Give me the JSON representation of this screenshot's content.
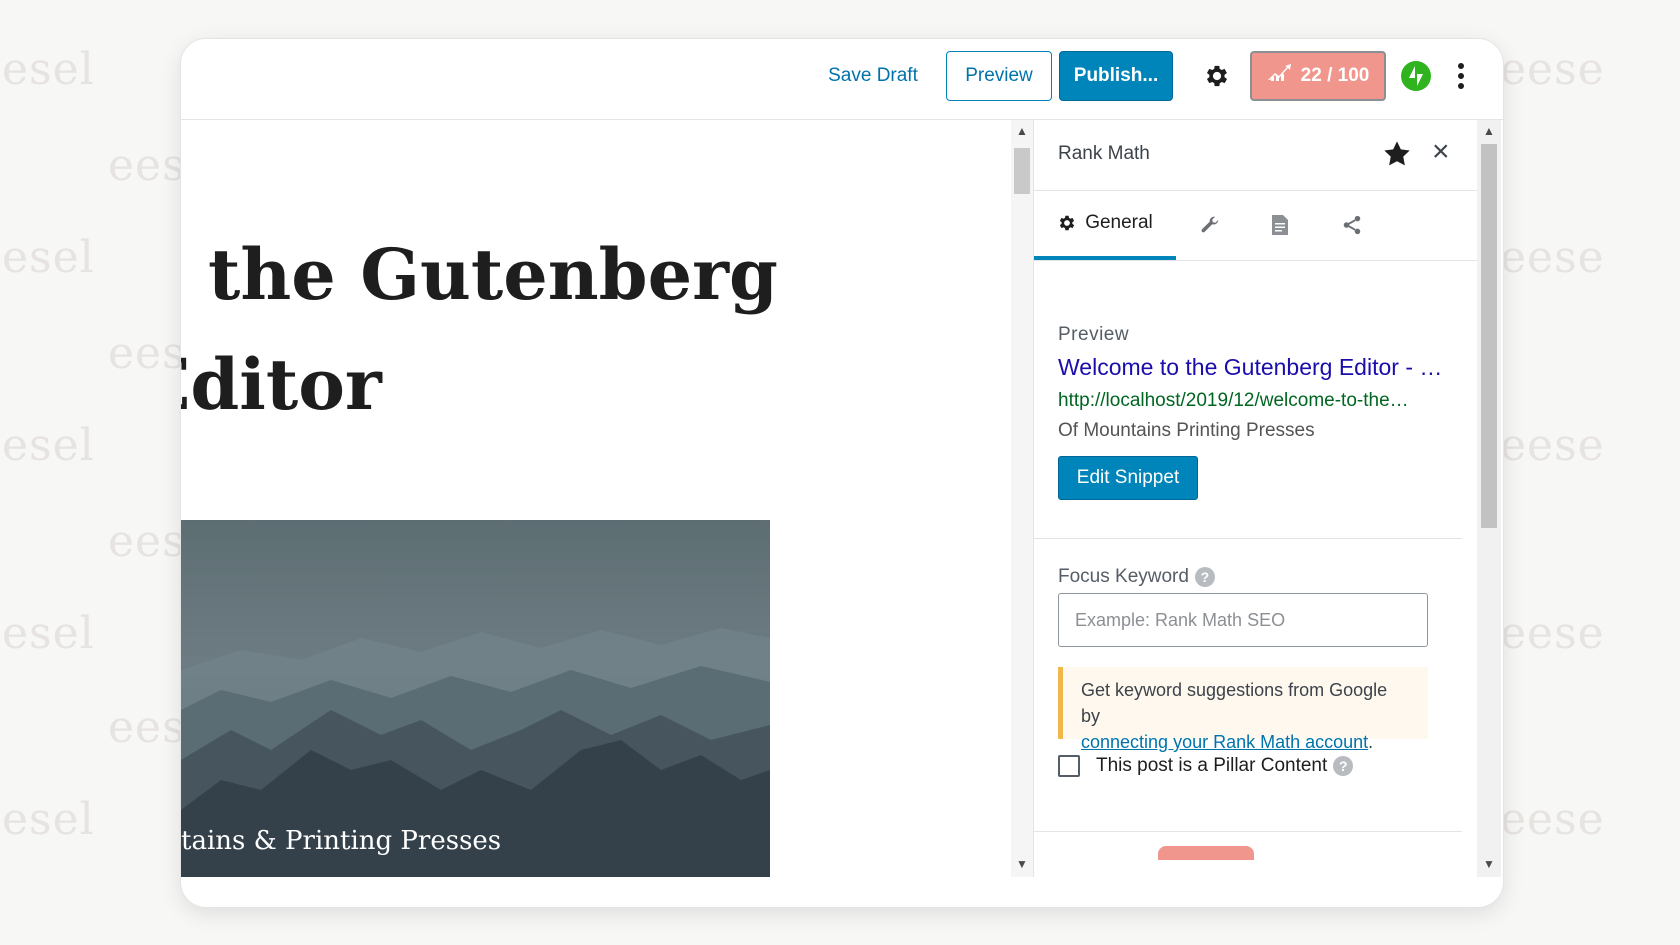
{
  "toolbar": {
    "save_draft": "Save Draft",
    "preview": "Preview",
    "publish": "Publish...",
    "seo_score": "22 / 100"
  },
  "editor": {
    "title_line1": "o the Gutenberg",
    "title_line2": "Editor",
    "image_caption": "tains & Printing Presses"
  },
  "sidebar": {
    "title": "Rank Math",
    "tabs": [
      {
        "label": "General",
        "icon": "gear-icon"
      },
      {
        "label": "",
        "icon": "wrench-icon"
      },
      {
        "label": "",
        "icon": "document-icon"
      },
      {
        "label": "",
        "icon": "share-icon"
      }
    ],
    "preview_label": "Preview",
    "snippet": {
      "title": "Welcome to the Gutenberg Editor - …",
      "url": "http://localhost/2019/12/welcome-to-the…",
      "description": "Of Mountains Printing Presses"
    },
    "edit_snippet": "Edit Snippet",
    "focus_keyword_label": "Focus Keyword",
    "focus_keyword_placeholder": "Example: Rank Math SEO",
    "notice_text": "Get keyword suggestions from Google by",
    "notice_link": "connecting your Rank Math account",
    "notice_suffix": ".",
    "pillar_label": "This post is a Pillar Content",
    "help_glyph": "?"
  },
  "watermark": "eesel",
  "colors": {
    "accent": "#0085ba",
    "score_badge": "#f1968c",
    "jetpack_green": "#2fb41f",
    "snippet_title": "#1a0dab",
    "snippet_url": "#006621"
  }
}
